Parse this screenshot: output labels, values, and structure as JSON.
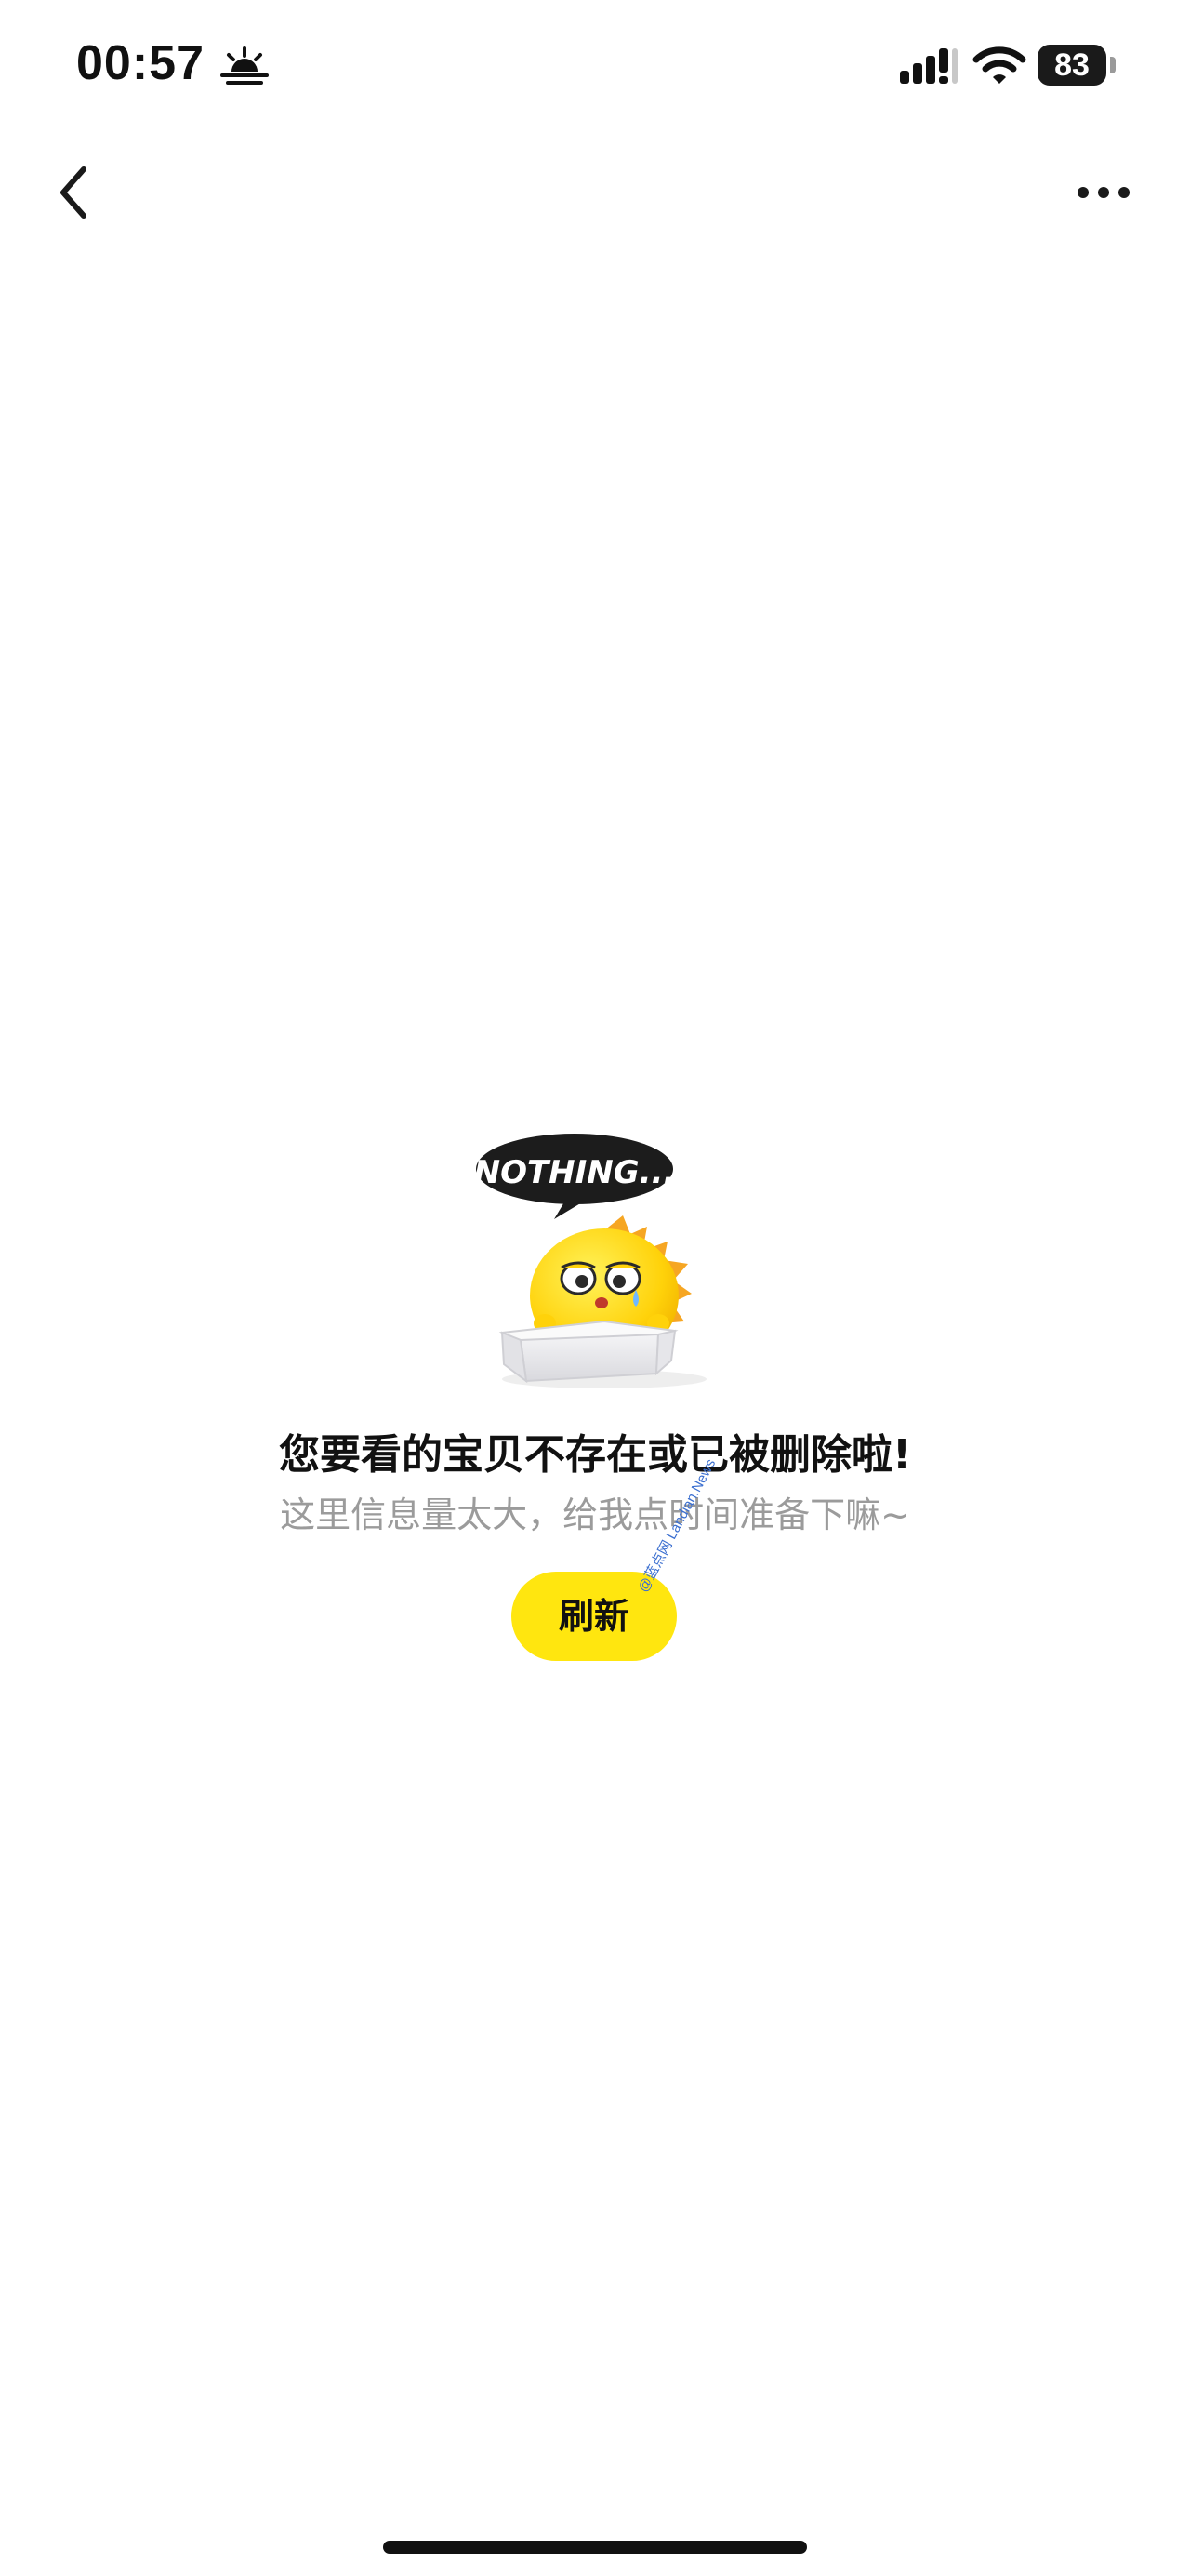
{
  "status_bar": {
    "time": "00:57",
    "battery": "83",
    "icons": [
      "sunrise-icon",
      "signal-icon",
      "wifi-icon",
      "battery-icon"
    ]
  },
  "nav": {
    "back_icon": "chevron-left-icon",
    "more_icon": "ellipsis-icon"
  },
  "empty_state": {
    "illustration_text": "NOTHING...",
    "title": "您要看的宝贝不存在或已被删除啦!",
    "subtitle": "这里信息量太大，给我点时间准备下嘛~",
    "refresh_label": "刷新"
  },
  "watermark": "@蓝点网 Landian.News",
  "colors": {
    "accent": "#ffe60f",
    "text_primary": "#111111",
    "text_secondary": "#9b9b9b",
    "background": "#ffffff"
  }
}
